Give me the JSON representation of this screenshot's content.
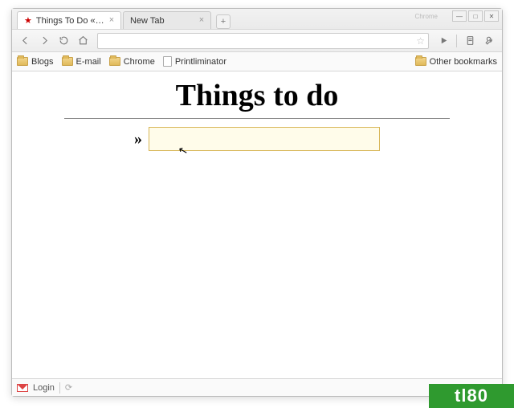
{
  "window": {
    "chrome_label": "Chrome"
  },
  "tabs": [
    {
      "title": "Things To Do « ...",
      "active": true
    },
    {
      "title": "New Tab",
      "active": false
    }
  ],
  "bookmarks": {
    "items": [
      {
        "label": "Blogs",
        "kind": "folder"
      },
      {
        "label": "E-mail",
        "kind": "folder"
      },
      {
        "label": "Chrome",
        "kind": "folder"
      },
      {
        "label": "Printliminator",
        "kind": "page"
      }
    ],
    "other_label": "Other bookmarks"
  },
  "page": {
    "heading": "Things to do",
    "prompt_symbol": "»",
    "input_value": "",
    "input_placeholder": ""
  },
  "status": {
    "login_label": "Login"
  },
  "watermark": "tl80"
}
